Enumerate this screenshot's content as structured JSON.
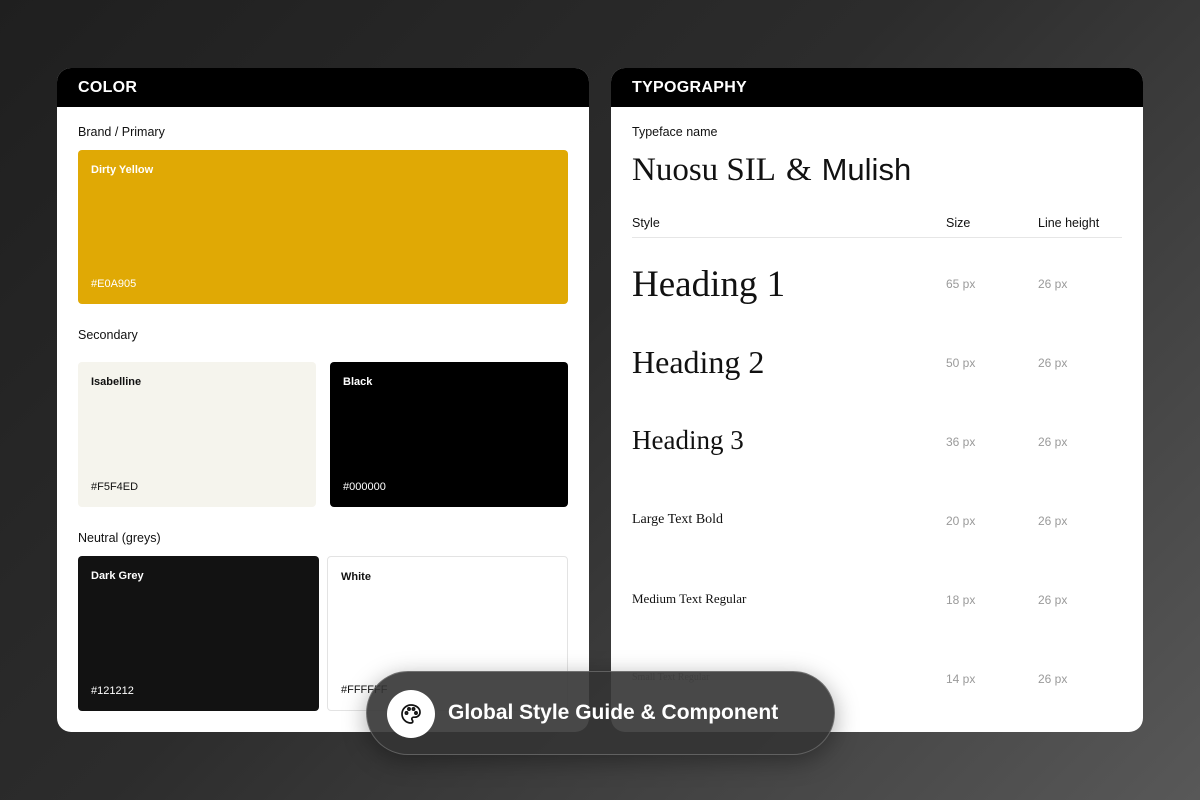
{
  "color_panel": {
    "title": "COLOR",
    "brand_label": "Brand / Primary",
    "brand_swatch": {
      "name": "Dirty Yellow",
      "hex": "#E0A905"
    },
    "secondary_label": "Secondary",
    "secondary_swatches": [
      {
        "name": "Isabelline",
        "hex": "#F5F4ED"
      },
      {
        "name": "Black",
        "hex": "#000000"
      }
    ],
    "neutral_label": "Neutral (greys)",
    "neutral_swatches": [
      {
        "name": "Dark Grey",
        "hex": "#121212"
      },
      {
        "name": "White",
        "hex": "#FFFFFF"
      }
    ]
  },
  "typography_panel": {
    "title": "TYPOGRAPHY",
    "typeface_label": "Typeface name",
    "typeface_primary": "Nuosu SIL",
    "typeface_separator": "&",
    "typeface_secondary": "Mulish",
    "columns": {
      "style": "Style",
      "size": "Size",
      "line_height": "Line height"
    },
    "rows": [
      {
        "style": "Heading 1",
        "size": "65 px",
        "line_height": "26 px"
      },
      {
        "style": "Heading 2",
        "size": "50 px",
        "line_height": "26 px"
      },
      {
        "style": "Heading 3",
        "size": "36 px",
        "line_height": "26 px"
      },
      {
        "style": "Large Text Bold",
        "size": "20 px",
        "line_height": "26 px"
      },
      {
        "style": "Medium Text Regular",
        "size": "18 px",
        "line_height": "26 px"
      },
      {
        "style": "Small Text Regular",
        "size": "14 px",
        "line_height": "26 px"
      }
    ]
  },
  "footer_pill": {
    "icon": "palette-icon",
    "label": "Global Style Guide & Component"
  },
  "colors": {
    "brand": "#E0A905",
    "panel_header": "#000000",
    "panel_body": "#FFFFFF",
    "muted_text": "#9A9A9A"
  }
}
